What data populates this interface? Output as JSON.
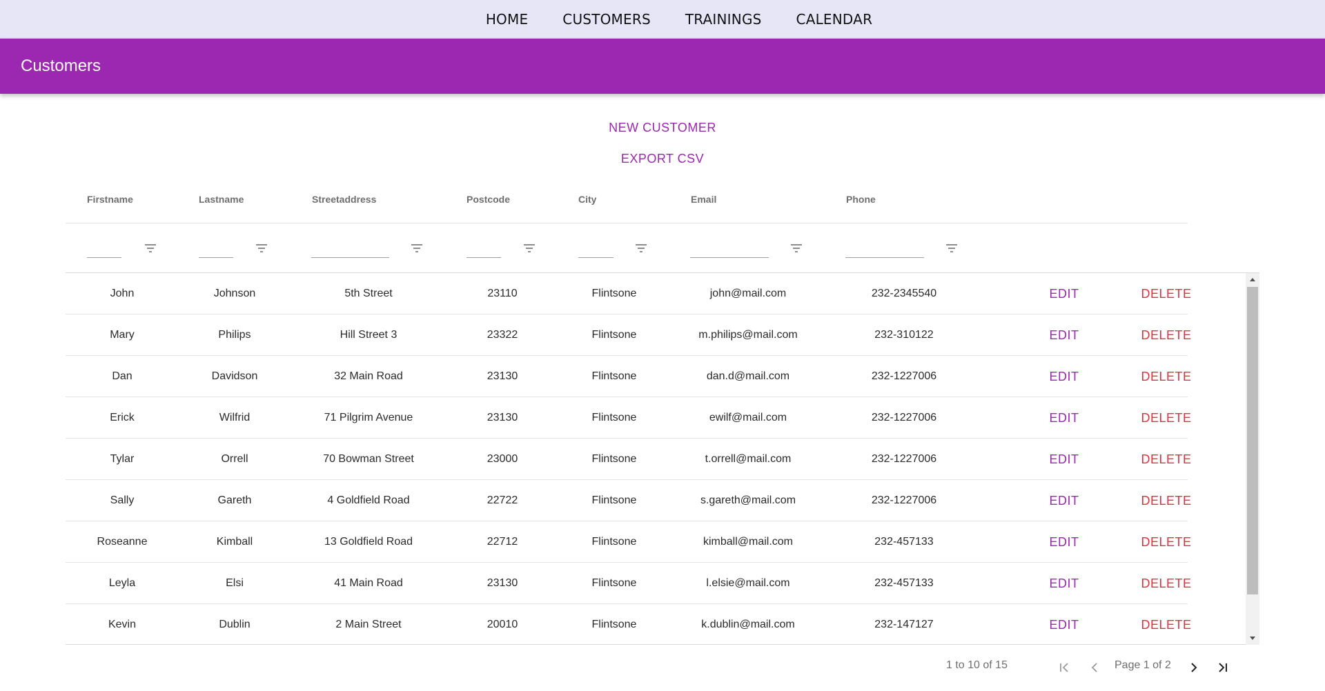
{
  "nav": {
    "items": [
      {
        "label": "HOME"
      },
      {
        "label": "CUSTOMERS"
      },
      {
        "label": "TRAININGS"
      },
      {
        "label": "CALENDAR"
      }
    ]
  },
  "appbar": {
    "title": "Customers"
  },
  "actions": {
    "new_customer": "NEW CUSTOMER",
    "export_csv": "EXPORT CSV"
  },
  "table": {
    "columns": [
      "Firstname",
      "Lastname",
      "Streetaddress",
      "Postcode",
      "City",
      "Email",
      "Phone"
    ],
    "edit_label": "EDIT",
    "delete_label": "DELETE",
    "rows": [
      {
        "firstname": "John",
        "lastname": "Johnson",
        "street": "5th Street",
        "postcode": "23110",
        "city": "Flintsone",
        "email": "john@mail.com",
        "phone": "232-2345540"
      },
      {
        "firstname": "Mary",
        "lastname": "Philips",
        "street": "Hill Street 3",
        "postcode": "23322",
        "city": "Flintsone",
        "email": "m.philips@mail.com",
        "phone": "232-310122"
      },
      {
        "firstname": "Dan",
        "lastname": "Davidson",
        "street": "32 Main Road",
        "postcode": "23130",
        "city": "Flintsone",
        "email": "dan.d@mail.com",
        "phone": "232-1227006"
      },
      {
        "firstname": "Erick",
        "lastname": "Wilfrid",
        "street": "71 Pilgrim Avenue",
        "postcode": "23130",
        "city": "Flintsone",
        "email": "ewilf@mail.com",
        "phone": "232-1227006"
      },
      {
        "firstname": "Tylar",
        "lastname": "Orrell",
        "street": "70 Bowman Street",
        "postcode": "23000",
        "city": "Flintsone",
        "email": "t.orrell@mail.com",
        "phone": "232-1227006"
      },
      {
        "firstname": "Sally",
        "lastname": "Gareth",
        "street": "4 Goldfield Road",
        "postcode": "22722",
        "city": "Flintsone",
        "email": "s.gareth@mail.com",
        "phone": "232-1227006"
      },
      {
        "firstname": "Roseanne",
        "lastname": "Kimball",
        "street": "13 Goldfield Road",
        "postcode": "22712",
        "city": "Flintsone",
        "email": "kimball@mail.com",
        "phone": "232-457133"
      },
      {
        "firstname": "Leyla",
        "lastname": "Elsi",
        "street": "41 Main Road",
        "postcode": "23130",
        "city": "Flintsone",
        "email": "l.elsie@mail.com",
        "phone": "232-457133"
      },
      {
        "firstname": "Kevin",
        "lastname": "Dublin",
        "street": "2 Main Street",
        "postcode": "20010",
        "city": "Flintsone",
        "email": "k.dublin@mail.com",
        "phone": "232-147127"
      }
    ]
  },
  "pagination": {
    "summary": "1 to 10 of 15",
    "page_label": "Page 1 of 2"
  },
  "colors": {
    "primary": "#9c27b0",
    "danger": "#e0303e",
    "nav_bg": "#e6e6f7"
  }
}
